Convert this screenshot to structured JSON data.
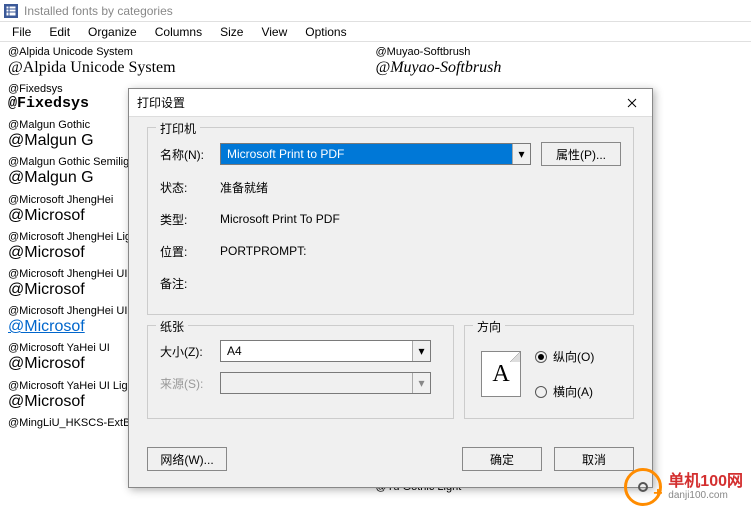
{
  "window": {
    "title": "Installed fonts by categories"
  },
  "menu": [
    "File",
    "Edit",
    "Organize",
    "Columns",
    "Size",
    "View",
    "Options"
  ],
  "fonts": {
    "col1": [
      {
        "name": "@Alpida Unicode System",
        "sample": "@Alpida Unicode System",
        "cls": "serif"
      },
      {
        "name": "@Fixedsys",
        "sample": "@Fixedsys",
        "cls": "mono"
      },
      {
        "name": "@Malgun Gothic",
        "sample": "@Malgun G",
        "cls": "sans"
      },
      {
        "name": "@Malgun Gothic Semilight",
        "sample": "@Malgun G",
        "cls": "sans"
      },
      {
        "name": "@Microsoft JhengHei",
        "sample": "@Microsof",
        "cls": "ms"
      },
      {
        "name": "@Microsoft JhengHei Light",
        "sample": "@Microsof",
        "cls": "ms"
      },
      {
        "name": "@Microsoft JhengHei UI",
        "sample": "@Microsof",
        "cls": "ms"
      },
      {
        "name": "@Microsoft JhengHei UI Light",
        "sample": "@Microsof",
        "cls": "ms link"
      },
      {
        "name": "@Microsoft YaHei UI",
        "sample": "@Microsof",
        "cls": "ms"
      },
      {
        "name": "@Microsoft YaHei UI Light",
        "sample": "@Microsof",
        "cls": "ms"
      },
      {
        "name": "@MingLiU_HKSCS-ExtB",
        "sample": "",
        "cls": ""
      }
    ],
    "col2": [
      {
        "name": "@Muyao-Softbrush",
        "sample": "@Muyao-Softbrush",
        "cls": "script"
      },
      {
        "name": "@Yu Gothic Light",
        "sample": "",
        "cls": ""
      }
    ]
  },
  "dialog": {
    "title": "打印设置",
    "printer": {
      "group_title": "打印机",
      "name_label": "名称(N):",
      "name_value": "Microsoft Print to PDF",
      "props_btn": "属性(P)...",
      "status_label": "状态:",
      "status_value": "准备就绪",
      "type_label": "类型:",
      "type_value": "Microsoft Print To PDF",
      "location_label": "位置:",
      "location_value": "PORTPROMPT:",
      "comment_label": "备注:",
      "comment_value": ""
    },
    "paper": {
      "group_title": "纸张",
      "size_label": "大小(Z):",
      "size_value": "A4",
      "source_label": "来源(S):",
      "source_value": ""
    },
    "orient": {
      "group_title": "方向",
      "portrait": "纵向(O)",
      "landscape": "横向(A)",
      "icon_letter": "A"
    },
    "buttons": {
      "network": "网络(W)...",
      "ok": "确定",
      "cancel": "取消"
    }
  },
  "watermark": {
    "line1": "单机100网",
    "line2": "danji100.com"
  }
}
